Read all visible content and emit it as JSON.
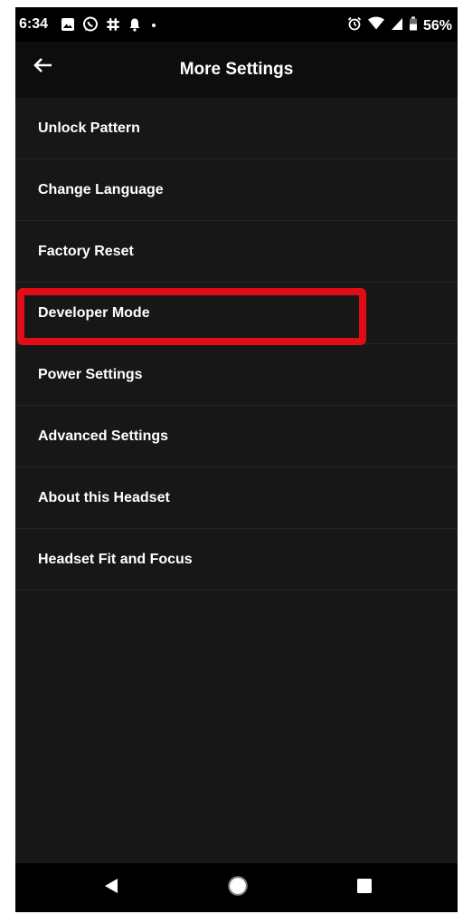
{
  "status_bar": {
    "time": "6:34",
    "battery_percent": "56%",
    "left_icons": [
      "image-icon",
      "whatsapp-icon",
      "slack-icon",
      "notification-icon",
      "dot-icon"
    ],
    "right_icons": [
      "alarm-icon",
      "wifi-icon",
      "signal-icon",
      "battery-icon"
    ]
  },
  "app_bar": {
    "title": "More Settings",
    "back_icon": "arrow-left-icon"
  },
  "settings": {
    "items": [
      {
        "label": "Unlock Pattern"
      },
      {
        "label": "Change Language"
      },
      {
        "label": "Factory Reset"
      },
      {
        "label": "Developer Mode",
        "highlighted": true
      },
      {
        "label": "Power Settings"
      },
      {
        "label": "Advanced Settings"
      },
      {
        "label": "About this Headset"
      },
      {
        "label": "Headset Fit and Focus"
      }
    ]
  },
  "nav_bar": {
    "buttons": [
      "back-triangle-icon",
      "home-circle-icon",
      "recents-square-icon"
    ]
  },
  "colors": {
    "background": "#171717",
    "app_bar": "#0d0d0d",
    "status_bar": "#000000",
    "text": "#ffffff",
    "divider": "#262626",
    "highlight": "#e10d16"
  }
}
